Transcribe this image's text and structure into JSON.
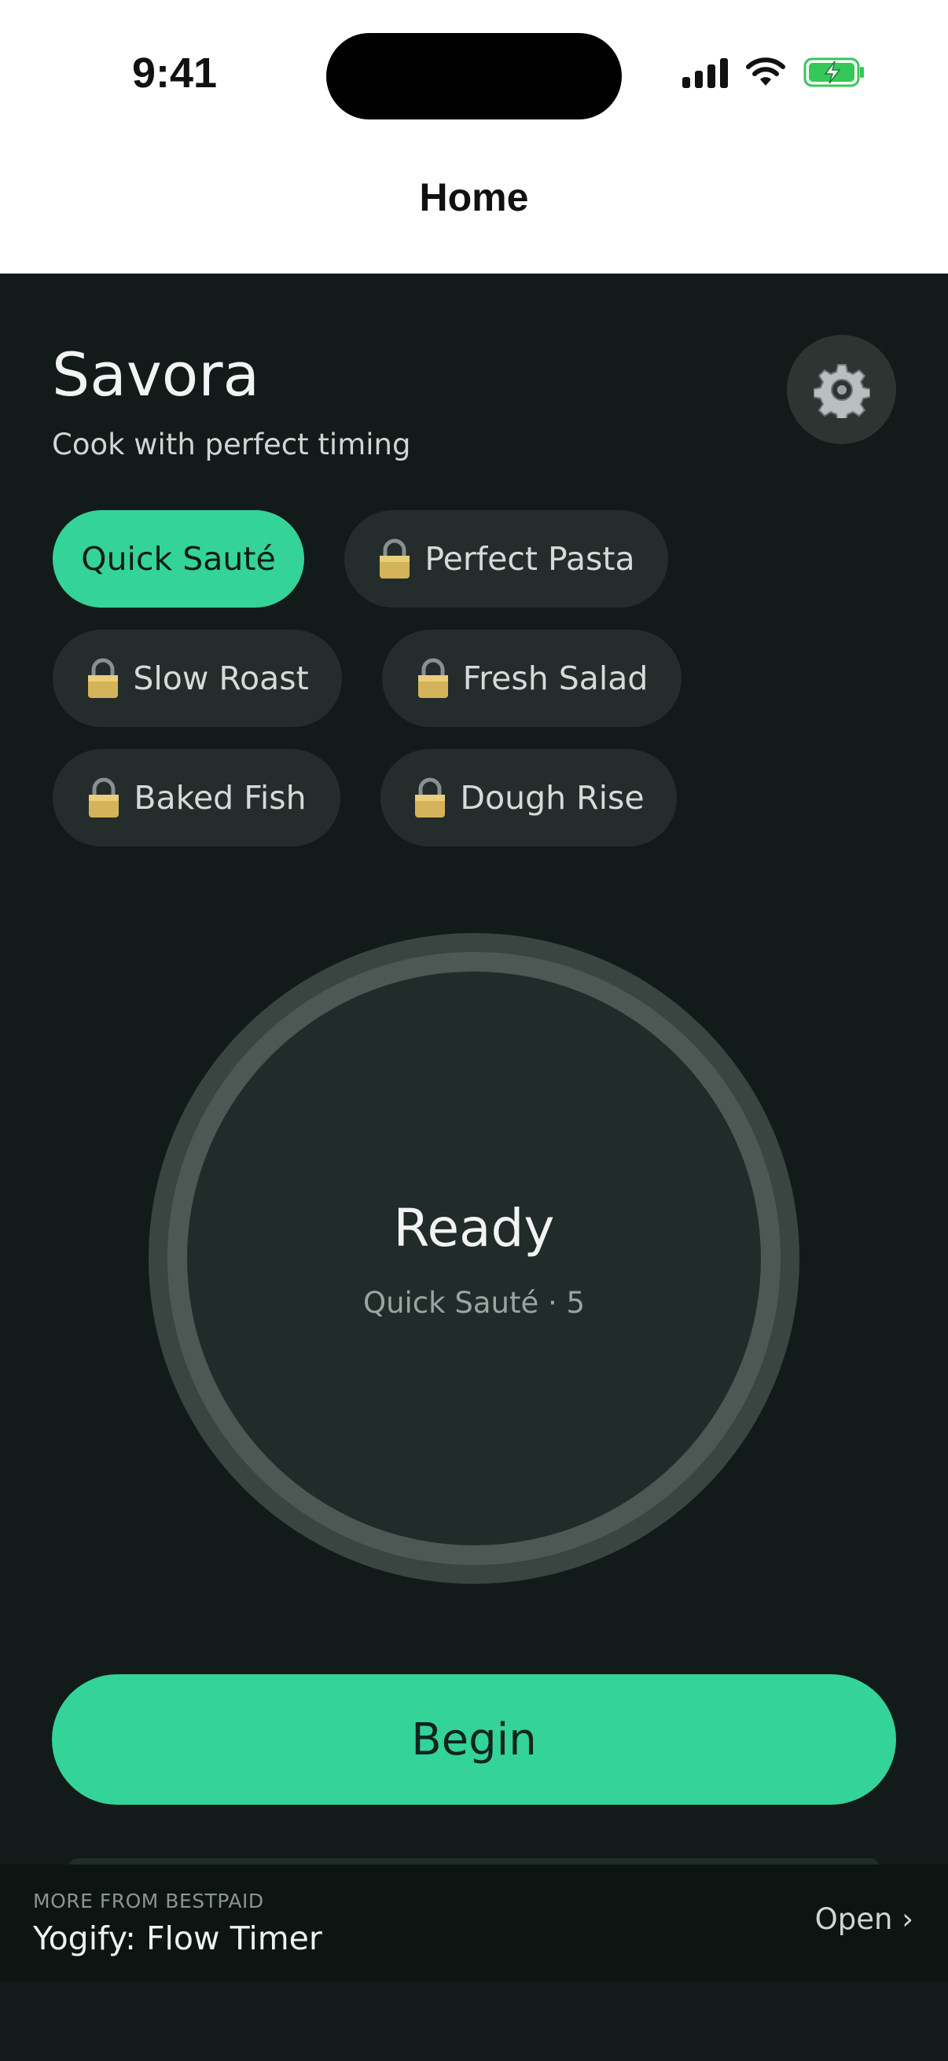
{
  "status_bar": {
    "time": "9:41",
    "battery_color": "#34c759"
  },
  "nav": {
    "title": "Home"
  },
  "header": {
    "title": "Savora",
    "subtitle": "Cook with perfect timing",
    "settings_icon": "gear-icon"
  },
  "presets": [
    {
      "label": "Quick Sauté",
      "locked": false,
      "selected": true
    },
    {
      "label": "Perfect Pasta",
      "locked": true,
      "selected": false
    },
    {
      "label": "Slow Roast",
      "locked": true,
      "selected": false
    },
    {
      "label": "Fresh Salad",
      "locked": true,
      "selected": false
    },
    {
      "label": "Baked Fish",
      "locked": true,
      "selected": false
    },
    {
      "label": "Dough Rise",
      "locked": true,
      "selected": false
    }
  ],
  "timer": {
    "state": "Ready",
    "detail": "Quick Sauté · 5"
  },
  "actions": {
    "begin_label": "Begin"
  },
  "promo": {
    "kicker": "MORE FROM BESTPAID",
    "title": "Yogify: Flow Timer",
    "open_label": "Open ›"
  },
  "colors": {
    "accent": "#34d399",
    "background": "#121b19",
    "chip": "#242d2b"
  }
}
